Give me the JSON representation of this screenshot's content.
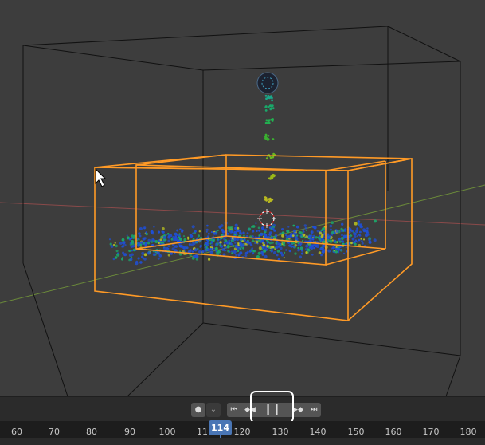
{
  "viewport": {
    "name": "3d-viewport",
    "colors": {
      "background": "#3d3d3d",
      "domain_outline": "#ff9a26",
      "particles_low": "#1f4fd6",
      "particles_mid": "#1aa86a",
      "particles_high": "#b8c020"
    }
  },
  "playback": {
    "record_icon": "record-dot-icon",
    "keying_dropdown_icon": "chevron-down-icon",
    "jump_start_icon": "jump-to-start-icon",
    "prev_keyframe_icon": "previous-keyframe-icon",
    "pause_icon": "pause-icon",
    "next_keyframe_icon": "next-keyframe-icon",
    "jump_end_icon": "jump-to-end-icon",
    "state": "playing"
  },
  "timeline": {
    "ticks": [
      "60",
      "70",
      "80",
      "90",
      "100",
      "11",
      "120",
      "130",
      "140",
      "150",
      "160",
      "170",
      "180"
    ],
    "current_frame": "114"
  }
}
